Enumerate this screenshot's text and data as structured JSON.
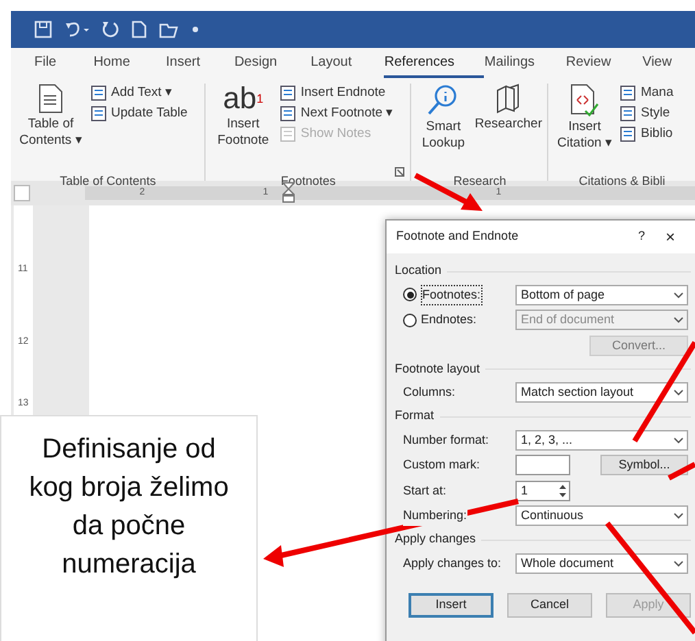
{
  "ribbon": {
    "tabs": [
      {
        "label": "File",
        "selected": false
      },
      {
        "label": "Home",
        "selected": false
      },
      {
        "label": "Insert",
        "selected": false
      },
      {
        "label": "Design",
        "selected": false
      },
      {
        "label": "Layout",
        "selected": false
      },
      {
        "label": "References",
        "selected": true
      },
      {
        "label": "Mailings",
        "selected": false
      },
      {
        "label": "Review",
        "selected": false
      },
      {
        "label": "View",
        "selected": false
      }
    ],
    "groups": [
      {
        "label": "Table of Contents",
        "large": {
          "label": "Table of Contents ▾"
        },
        "small": [
          {
            "label": "Add Text ▾",
            "disabled": false
          },
          {
            "label": "Update Table",
            "disabled": false
          }
        ]
      },
      {
        "label": "Footnotes",
        "large": {
          "label": "Insert Footnote",
          "icon_text": "ab",
          "icon_sup": "1"
        },
        "small": [
          {
            "label": "Insert Endnote",
            "disabled": false
          },
          {
            "label": "Next Footnote  ▾",
            "disabled": false
          },
          {
            "label": "Show Notes",
            "disabled": true
          }
        ]
      },
      {
        "label": "Research",
        "large": {
          "label": "Smart Lookup"
        },
        "large2": {
          "label": "Researcher"
        }
      },
      {
        "label": "Citations & Bibli",
        "large": {
          "label": "Insert Citation ▾"
        },
        "small": [
          {
            "label": "Mana",
            "disabled": false
          },
          {
            "label": "Style",
            "disabled": false
          },
          {
            "label": "Biblio",
            "disabled": false
          }
        ]
      }
    ]
  },
  "ruler": {
    "h_labels": [
      "2",
      "1",
      "1"
    ],
    "v_labels": [
      "11",
      "12",
      "13"
    ]
  },
  "dialog": {
    "title": "Footnote and Endnote",
    "help": "?",
    "close": "×",
    "sections": [
      {
        "heading": "Location",
        "rows": [
          {
            "kind": "radio",
            "label": "Footnotes:",
            "selected": true,
            "value": "Bottom of page",
            "disabled": false
          },
          {
            "kind": "radio",
            "label": "Endnotes:",
            "selected": false,
            "value": "End of document",
            "disabled": true
          },
          {
            "kind": "button",
            "label": "Convert..."
          }
        ]
      },
      {
        "heading": "Footnote layout",
        "rows": [
          {
            "kind": "select",
            "label": "Columns:",
            "value": "Match section layout"
          }
        ]
      },
      {
        "heading": "Format",
        "rows": [
          {
            "kind": "select",
            "label": "Number format:",
            "value": "1, 2, 3, ..."
          },
          {
            "kind": "mark",
            "label": "Custom mark:",
            "button": "Symbol..."
          },
          {
            "kind": "spin",
            "label": "Start at:",
            "value": "1"
          },
          {
            "kind": "select",
            "label": "Numbering:",
            "value": "Continuous"
          }
        ]
      },
      {
        "heading": "Apply changes",
        "rows": [
          {
            "kind": "select",
            "label": "Apply changes to:",
            "value": "Whole document"
          }
        ]
      }
    ],
    "buttons": [
      {
        "label": "Insert",
        "default": true,
        "disabled": false
      },
      {
        "label": "Cancel",
        "default": false,
        "disabled": false
      },
      {
        "label": "Apply",
        "default": false,
        "disabled": true
      }
    ]
  },
  "callout": {
    "text": "Definisanje od kog broja želimo da počne numeracija"
  }
}
